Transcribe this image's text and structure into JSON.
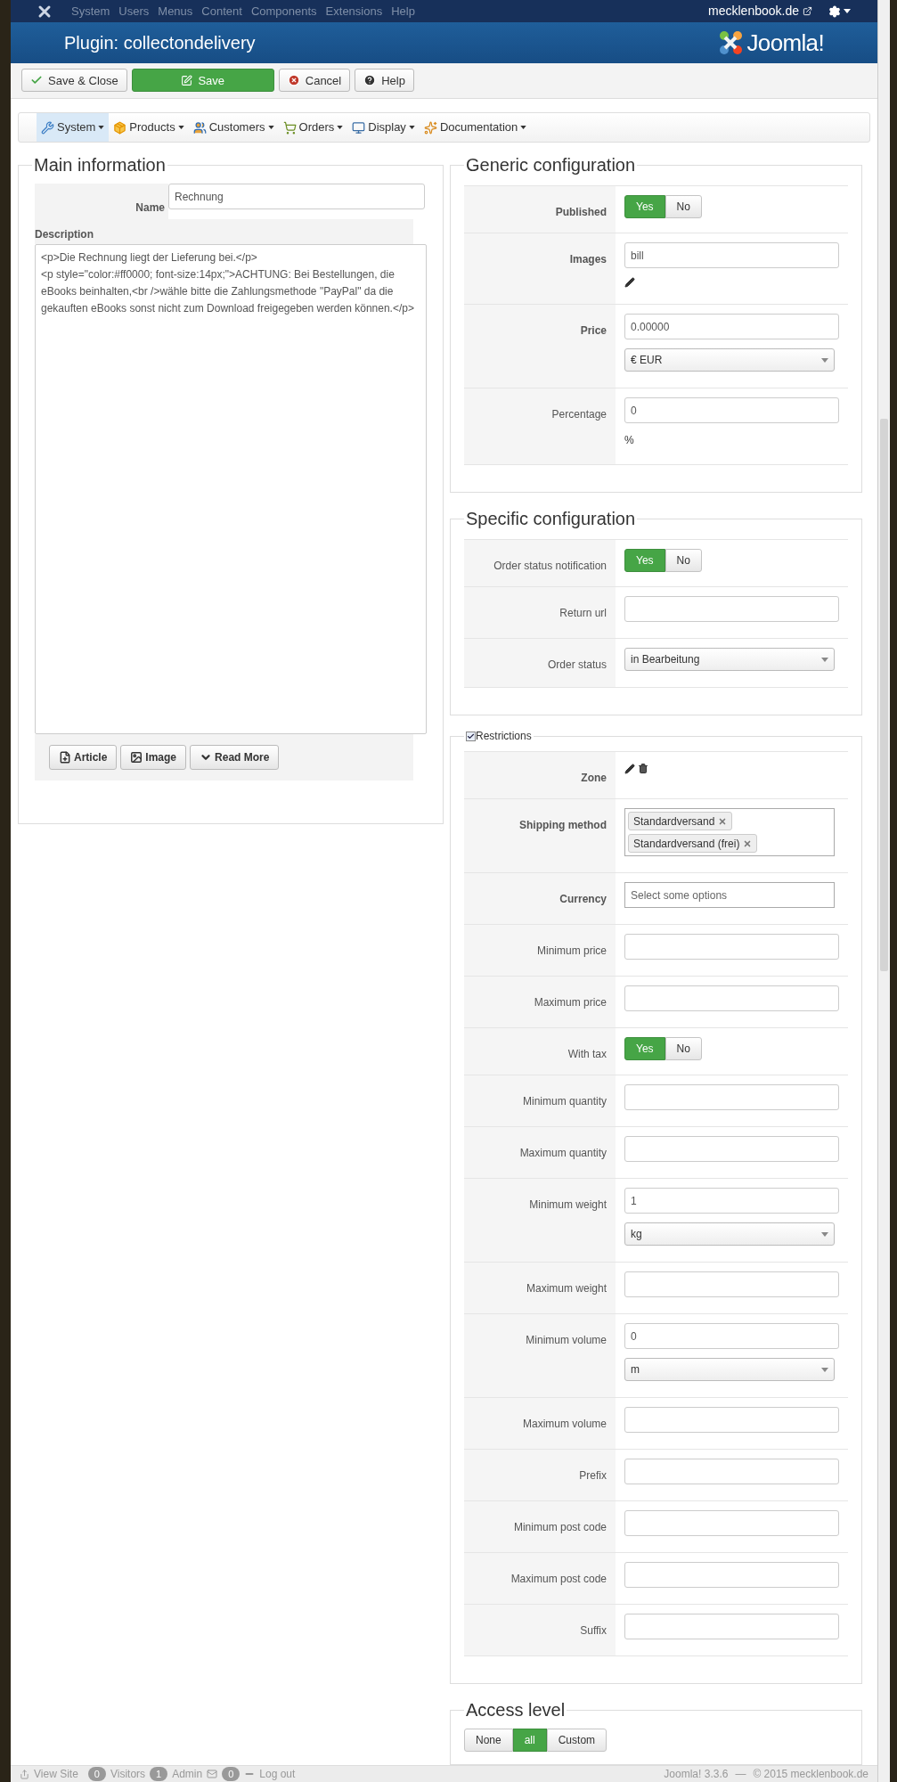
{
  "top_menu": {
    "items": [
      "System",
      "Users",
      "Menus",
      "Content",
      "Components",
      "Extensions",
      "Help"
    ],
    "site": "mecklenbook.de"
  },
  "header": {
    "title": "Plugin: collectondelivery",
    "logo_text": "Joomla!"
  },
  "toolbar": [
    {
      "label": "Save & Close",
      "kind": "save-close"
    },
    {
      "label": "Save",
      "kind": "save"
    },
    {
      "label": "Cancel",
      "kind": "cancel"
    },
    {
      "label": "Help",
      "kind": "help"
    }
  ],
  "submenu": [
    {
      "label": "System",
      "kind": "system",
      "selected": true
    },
    {
      "label": "Products",
      "kind": "products",
      "selected": false
    },
    {
      "label": "Customers",
      "kind": "customers",
      "selected": false
    },
    {
      "label": "Orders",
      "kind": "orders",
      "selected": false
    },
    {
      "label": "Display",
      "kind": "display",
      "selected": false
    },
    {
      "label": "Documentation",
      "kind": "documentation",
      "selected": false
    }
  ],
  "main_information": {
    "title": "Main information",
    "name_label": "Name",
    "name_value": "Rechnung",
    "description_label": "Description",
    "description": "<p>Die Rechnung liegt der Lieferung bei.</p>\n<p style=\"color:#ff0000; font-size:14px;\">ACHTUNG: Bei Bestellungen, die eBooks beinhalten,<br />wähle bitte die Zahlungsmethode \"PayPal\" da die gekauften eBooks sonst nicht zum Download freigegeben werden können.</p>",
    "editor_buttons": [
      {
        "label": "Article",
        "kind": "article"
      },
      {
        "label": "Image",
        "kind": "image"
      },
      {
        "label": "Read More",
        "kind": "readmore"
      }
    ]
  },
  "generic_configuration": {
    "title": "Generic configuration",
    "rows": [
      {
        "label": "Published",
        "bold": true,
        "kind": "toggle",
        "options": [
          {
            "label": "Yes",
            "selected": true
          },
          {
            "label": "No",
            "selected": false
          }
        ]
      },
      {
        "label": "Images",
        "bold": true,
        "kind": "image",
        "value": "bill"
      },
      {
        "label": "Price",
        "bold": true,
        "kind": "text",
        "value": "0.00000",
        "select": "€ EUR"
      },
      {
        "label": "Percentage",
        "bold": false,
        "kind": "text",
        "value": "0",
        "note": "%"
      }
    ]
  },
  "specific_configuration": {
    "title": "Specific configuration",
    "rows": [
      {
        "label": "Order status notification",
        "bold": false,
        "kind": "toggle",
        "options": [
          {
            "label": "Yes",
            "selected": true
          },
          {
            "label": "No",
            "selected": false
          }
        ]
      },
      {
        "label": "Return url",
        "bold": false,
        "kind": "text"
      },
      {
        "label": "Order status",
        "bold": false,
        "kind": "select",
        "select": "in Bearbeitung"
      }
    ]
  },
  "restrictions": {
    "title": "Restrictions",
    "checked": true,
    "rows": [
      {
        "label": "Zone",
        "bold": true,
        "kind": "icons"
      },
      {
        "label": "Shipping method",
        "bold": true,
        "kind": "tags",
        "tags": [
          "Standardversand",
          "Standardversand (frei)"
        ]
      },
      {
        "label": "Currency",
        "bold": true,
        "kind": "multiselect",
        "placeholder": "Select some options"
      },
      {
        "label": "Minimum price",
        "bold": false,
        "kind": "text"
      },
      {
        "label": "Maximum price",
        "bold": false,
        "kind": "text"
      },
      {
        "label": "With tax",
        "bold": false,
        "kind": "toggle",
        "options": [
          {
            "label": "Yes",
            "selected": true
          },
          {
            "label": "No",
            "selected": false
          }
        ]
      },
      {
        "label": "Minimum quantity",
        "bold": false,
        "kind": "text"
      },
      {
        "label": "Maximum quantity",
        "bold": false,
        "kind": "text"
      },
      {
        "label": "Minimum weight",
        "bold": false,
        "kind": "text",
        "value": "1",
        "select": "kg"
      },
      {
        "label": "Maximum weight",
        "bold": false,
        "kind": "text"
      },
      {
        "label": "Minimum volume",
        "bold": false,
        "kind": "text",
        "value": "0",
        "select": "m"
      },
      {
        "label": "Maximum volume",
        "bold": false,
        "kind": "text"
      },
      {
        "label": "Prefix",
        "bold": false,
        "kind": "text"
      },
      {
        "label": "Minimum post code",
        "bold": false,
        "kind": "text"
      },
      {
        "label": "Maximum post code",
        "bold": false,
        "kind": "text"
      },
      {
        "label": "Suffix",
        "bold": false,
        "kind": "text"
      }
    ]
  },
  "access_level": {
    "title": "Access level",
    "options": [
      {
        "label": "None",
        "selected": false
      },
      {
        "label": "all",
        "selected": true
      },
      {
        "label": "Custom",
        "selected": false
      }
    ]
  },
  "status_bar": {
    "view_site": "View Site",
    "visitors_count": "0",
    "visitors": "Visitors",
    "admin_count": "1",
    "admin": "Admin",
    "messages_count": "0",
    "logout": "Log out",
    "version": "Joomla! 3.3.6",
    "separator": "—",
    "copyright": "© 2015 mecklenbook.de"
  }
}
